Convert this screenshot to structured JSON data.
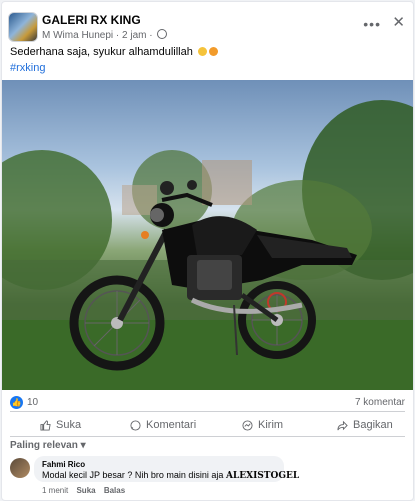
{
  "post": {
    "group_name": "GALERI RX KING",
    "author": "M Wima Hunepi",
    "time": "2 jam",
    "caption": "Sederhana saja, syukur alhamdulillah",
    "hashtag": "#rxking",
    "likes": "10",
    "comments_count": "7 komentar"
  },
  "actions": {
    "like": "Suka",
    "comment": "Komentari",
    "send": "Kirim",
    "share": "Bagikan"
  },
  "sort_label": "Paling relevan",
  "comment": {
    "name": "Fahmi Rico",
    "text": "Modal kecil JP besar ? Nih bro main disini aja",
    "bold": "ALEXISTOGEL",
    "time": "1 menit",
    "like": "Suka",
    "reply": "Balas"
  },
  "colors": {
    "link": "#216fdb",
    "like": "#1877f2"
  }
}
